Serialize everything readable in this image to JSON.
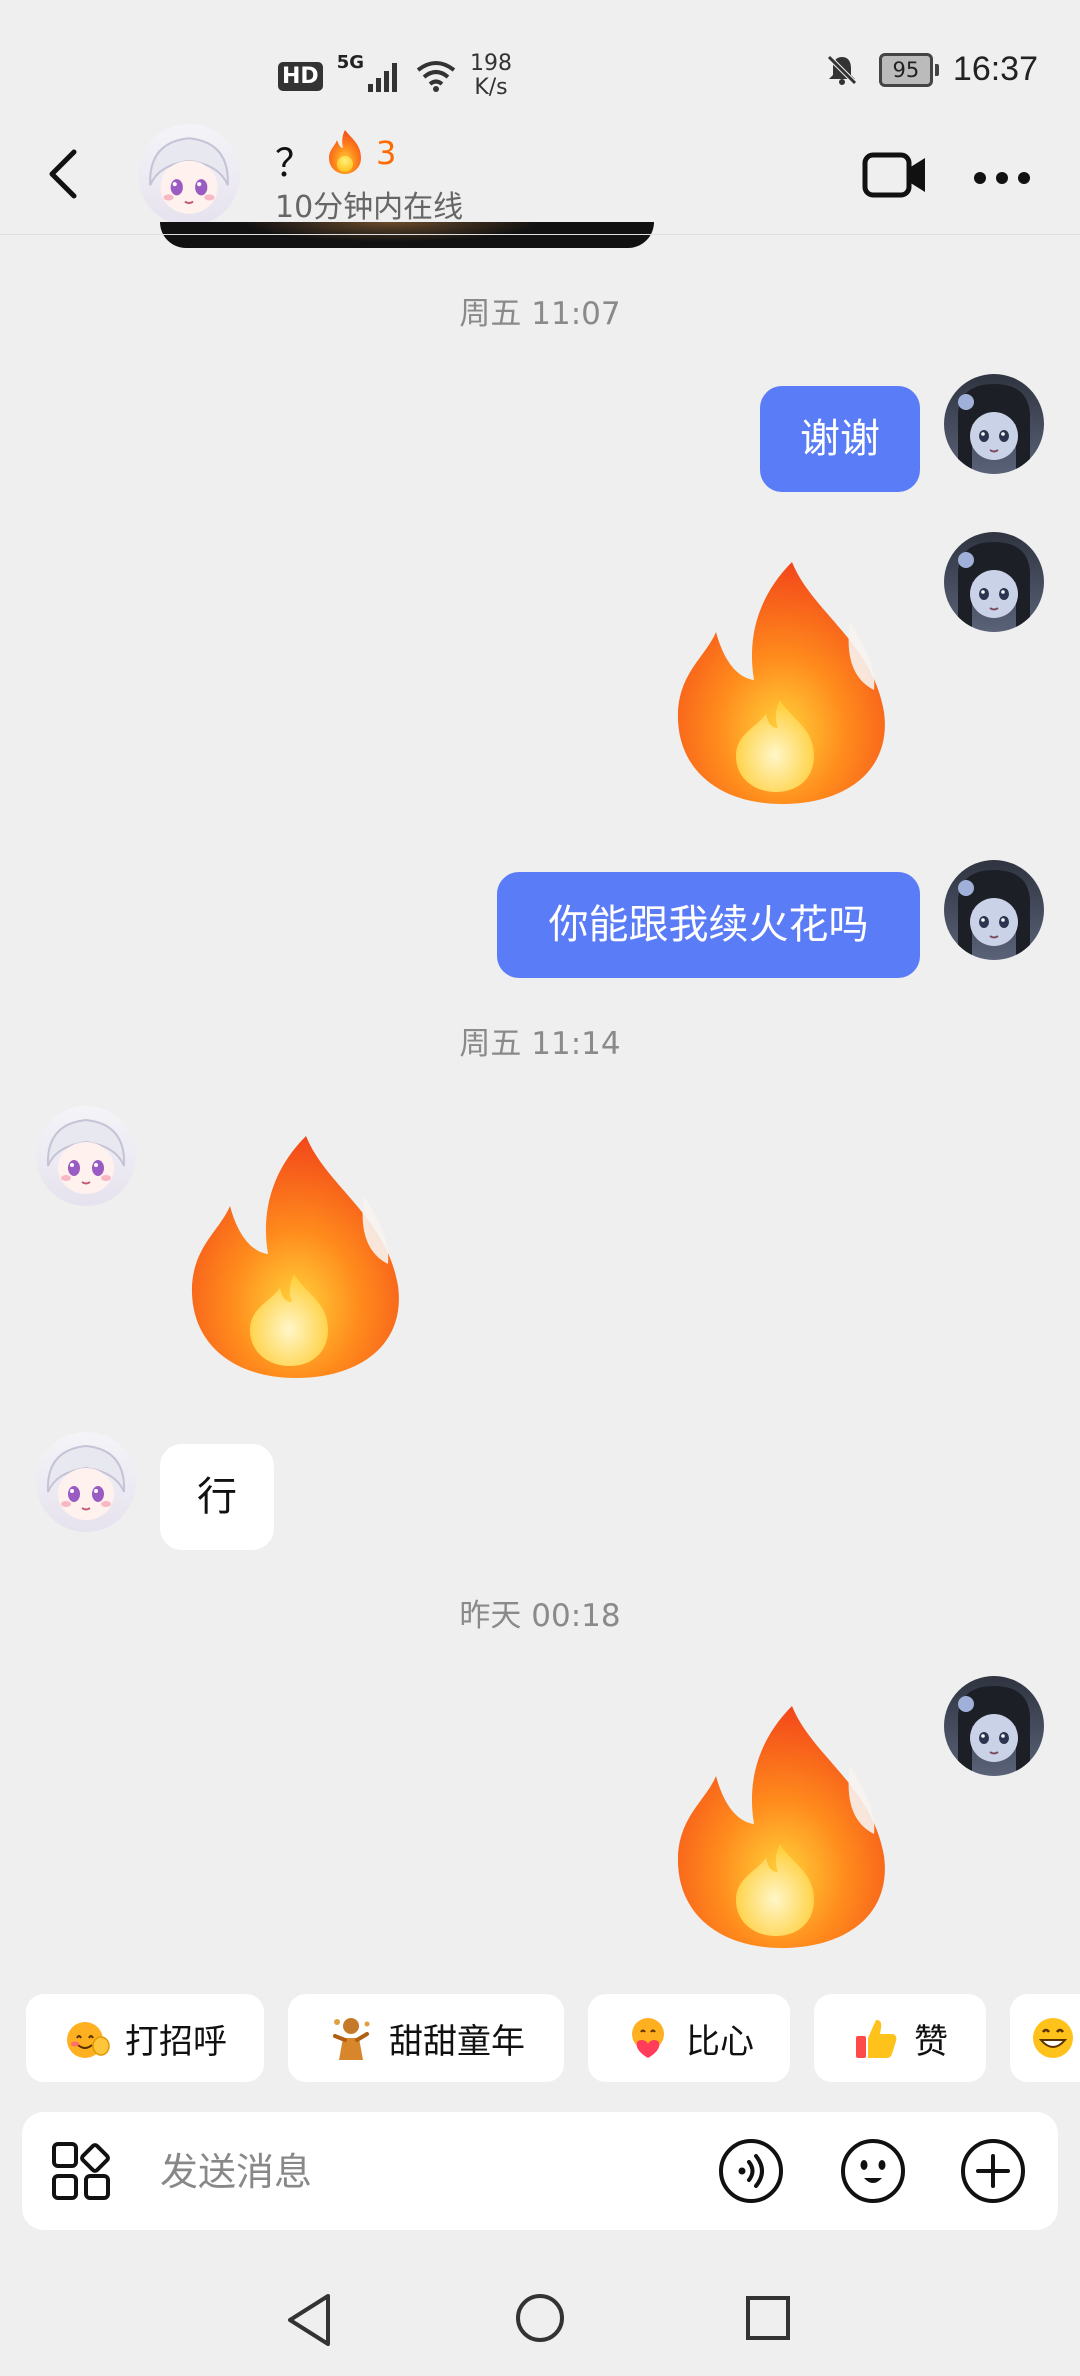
{
  "status_bar": {
    "hd": "HD",
    "network": "5G",
    "speed_value": "198",
    "speed_unit": "K/s",
    "battery": "95",
    "time": "16:37"
  },
  "header": {
    "contact_name": "？",
    "fire_count": "3",
    "online_status": "10分钟内在线"
  },
  "messages": {
    "ts1": "周五 11:07",
    "m1_text": "谢谢",
    "m3_text": "你能跟我续火花吗",
    "ts2": "周五 11:14",
    "m5_text": "行",
    "ts3": "昨天 00:18"
  },
  "quick_replies": [
    {
      "label": "打招呼",
      "icon": "waving-face-icon"
    },
    {
      "label": "甜甜童年",
      "icon": "child-figure-icon"
    },
    {
      "label": "比心",
      "icon": "heart-hands-face-icon"
    },
    {
      "label": "赞",
      "icon": "thumbs-up-icon"
    },
    {
      "label": "",
      "icon": "grinning-face-icon"
    }
  ],
  "input": {
    "placeholder": "发送消息"
  },
  "colors": {
    "my_bubble": "#5b7cf7",
    "fire_count": "#ff6a00",
    "background": "#efefef"
  }
}
